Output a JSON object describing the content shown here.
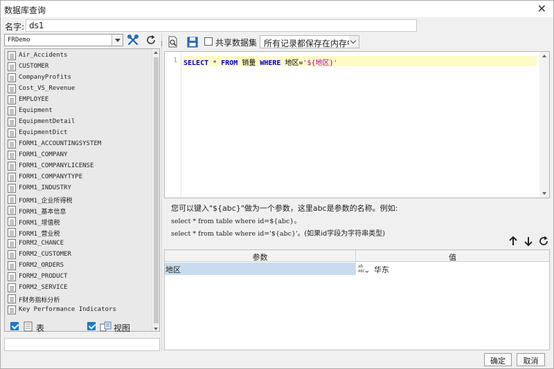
{
  "window": {
    "title": "数据库查询"
  },
  "name_field": {
    "label": "名字:",
    "value": "ds1"
  },
  "connection": {
    "selected": "FRDemo"
  },
  "tables": [
    "Air_Accidents",
    "CUSTOMER",
    "CompanyProfits",
    "Cost_VS_Revenue",
    "EMPLOYEE",
    "Equipment",
    "EquipmentDetail",
    "EquipmentDict",
    "FORM1_ACCOUNTINGSYSTEM",
    "FORM1_COMPANY",
    "FORM1_COMPANYLICENSE",
    "FORM1_COMPANYTYPE",
    "FORM1_INDUSTRY",
    "FORM1_企业所得税",
    "FORM1_基本信息",
    "FORM1_增值税",
    "FORM1_营业税",
    "FORM2_CHANCE",
    "FORM2_CUSTOMER",
    "FORM2_ORDERS",
    "FORM2_PRODUCT",
    "FORM2_SERVICE",
    "F财务指标分析",
    "Key Performance Indicators"
  ],
  "filters": {
    "table_label": "表",
    "view_label": "视图"
  },
  "toolbar": {
    "share_label": "共享数据集",
    "cache_mode": "所有记录都保存在内存中"
  },
  "editor": {
    "line_number": "1",
    "tokens": [
      {
        "text": "SELECT",
        "type": "kw"
      },
      {
        "text": " * ",
        "type": "op"
      },
      {
        "text": "FROM",
        "type": "kw"
      },
      {
        "text": " 销量 ",
        "type": "plain"
      },
      {
        "text": "WHERE",
        "type": "kw"
      },
      {
        "text": " 地区=",
        "type": "plain"
      },
      {
        "text": "'${地区}'",
        "type": "str"
      }
    ]
  },
  "help": {
    "line1": "您可以键入\"${abc}\"做为一个参数，这里abc是参数的名称。例如:",
    "line2": "select * from table where id=${abc}。",
    "line3_code": "select * from table where id='${abc}'。",
    "line3_note": "(如果id字段为字符串类型)"
  },
  "params": {
    "header_param": "参数",
    "header_value": "值",
    "rows": [
      {
        "name": "地区",
        "value": "华东"
      }
    ]
  },
  "buttons": {
    "ok": "确定",
    "cancel": "取消"
  }
}
